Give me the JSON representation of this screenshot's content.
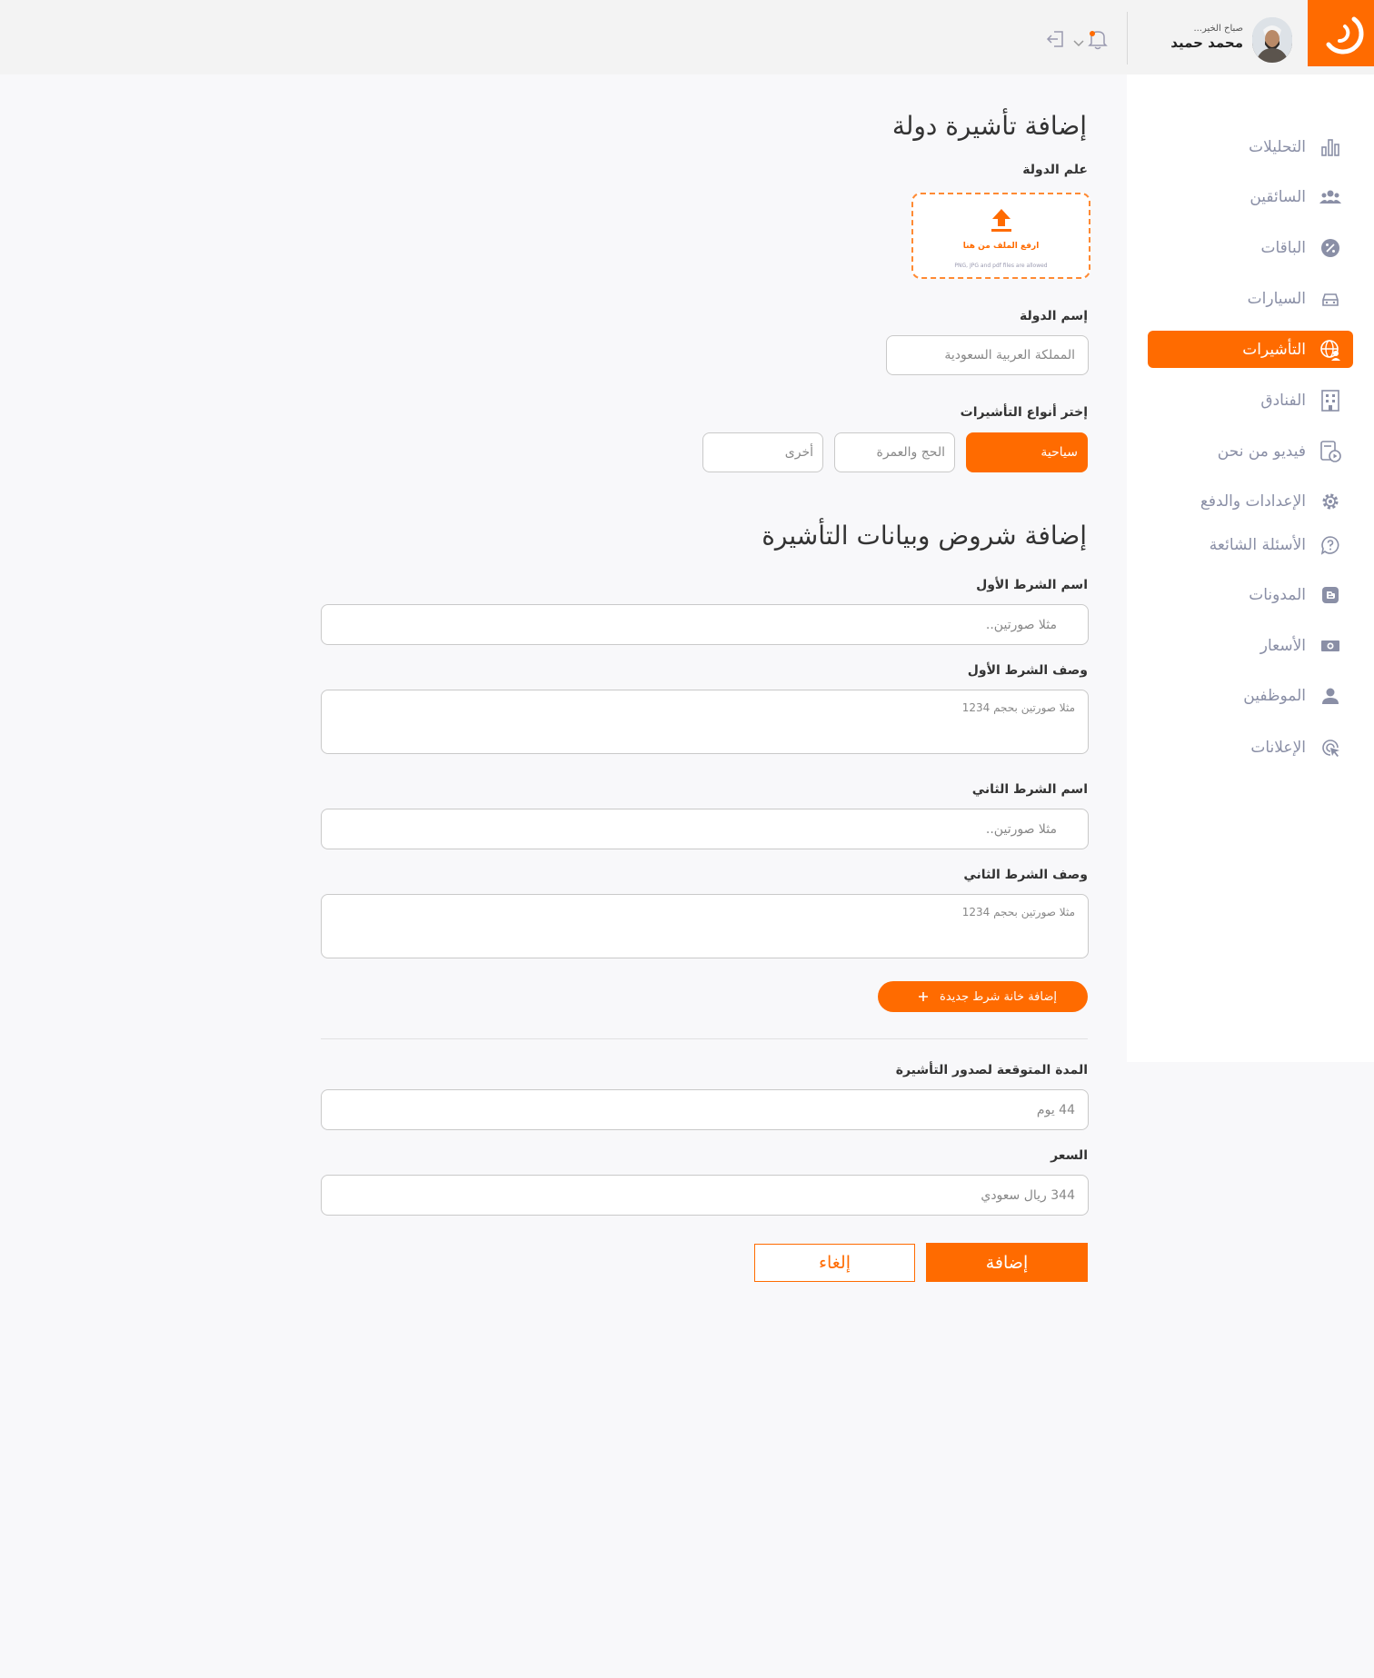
{
  "header": {
    "greeting": "صباح الخير...",
    "user_name": "محمد حميد"
  },
  "sidebar": {
    "items": [
      {
        "label": "التحليلات",
        "icon": "bar-chart-icon",
        "active": false
      },
      {
        "label": "السائقين",
        "icon": "users-icon",
        "active": false
      },
      {
        "label": "الباقات",
        "icon": "discount-badge-icon",
        "active": false
      },
      {
        "label": "السيارات",
        "icon": "car-icon",
        "active": false
      },
      {
        "label": "التأشيرات",
        "icon": "globe-user-icon",
        "active": true
      },
      {
        "label": "الفنادق",
        "icon": "building-icon",
        "active": false
      },
      {
        "label": "فيديو من نحن",
        "icon": "video-file-icon",
        "active": false
      },
      {
        "label": "الإعدادات والدفع",
        "icon": "gear-icon",
        "active": false
      },
      {
        "label": "الأسئلة الشائعة",
        "icon": "question-bubble-icon",
        "active": false
      },
      {
        "label": "المدونات",
        "icon": "blog-icon",
        "active": false
      },
      {
        "label": "الأسعار",
        "icon": "money-icon",
        "active": false
      },
      {
        "label": "الموظفين",
        "icon": "person-icon",
        "active": false
      },
      {
        "label": "الإعلانات",
        "icon": "cursor-click-icon",
        "active": false
      }
    ]
  },
  "form": {
    "title": "إضافة تأشيرة دولة",
    "flag_label": "علم الدولة",
    "upload_text": "ارفع الملف من هنا",
    "upload_hint": "PNG, JPG and pdf files are allowed",
    "country_label": "إسم الدولة",
    "country_placeholder": "المملكة العربية السعودية",
    "visa_types_label": "إختر أنواع التأشيرات",
    "visa_types": [
      {
        "label": "سياحية",
        "selected": true
      },
      {
        "label": "الحج والعمرة",
        "selected": false
      },
      {
        "label": "أخرى",
        "selected": false
      }
    ],
    "conditions_title": "إضافة شروض وبيانات التأشيرة",
    "cond1_name_label": "اسم الشرط الأول",
    "cond1_name_placeholder": "مثلا صورتين..",
    "cond1_desc_label": "وصف الشرط الأول",
    "cond1_desc_placeholder": "مثلا صورتين بحجم 1234",
    "cond2_name_label": "اسم الشرط الثاني",
    "cond2_name_placeholder": "مثلا صورتين..",
    "cond2_desc_label": "وصف الشرط الثاني",
    "cond2_desc_placeholder": "مثلا صورتين بحجم 1234",
    "add_condition_label": "إضافة خانة شرط جديدة",
    "duration_label": "المدة المتوقعة لصدور التأشيرة",
    "duration_placeholder": "44 يوم",
    "price_label": "السعر",
    "price_placeholder": "344 ريال سعودي",
    "submit_label": "إضافة",
    "cancel_label": "إلغاء"
  },
  "colors": {
    "accent": "#ff6b00",
    "sidebar_text": "#8a8fa6",
    "background": "#f8f8fa"
  }
}
